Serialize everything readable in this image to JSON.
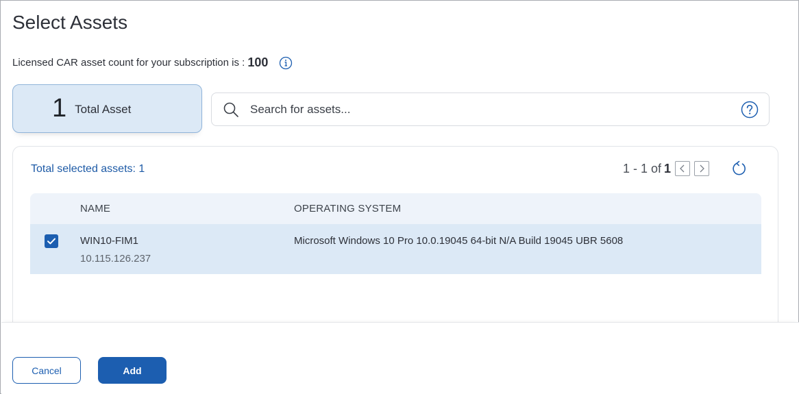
{
  "dialog": {
    "title": "Select Assets",
    "license_text": "Licensed CAR asset count for your subscription is :",
    "license_count": "100"
  },
  "summary": {
    "total_count": "1",
    "total_label": "Total Asset"
  },
  "search": {
    "placeholder": "Search for assets..."
  },
  "panel": {
    "selected_text": "Total selected assets: 1",
    "pager_text": "1 - 1 of",
    "pager_total": "1"
  },
  "table": {
    "columns": [
      "NAME",
      "OPERATING SYSTEM"
    ],
    "rows": [
      {
        "checked": true,
        "name": "WIN10-FIM1",
        "ip": "10.115.126.237",
        "os": "Microsoft Windows 10 Pro 10.0.19045 64-bit N/A Build 19045 UBR 5608"
      }
    ]
  },
  "footer": {
    "cancel_label": "Cancel",
    "add_label": "Add"
  },
  "icons": {
    "info": "info-icon",
    "search": "search-icon",
    "help": "help-icon",
    "prev": "chevron-left-icon",
    "next": "chevron-right-icon",
    "refresh": "refresh-icon",
    "check": "checkmark-icon"
  },
  "colors": {
    "accent": "#1c5eb0",
    "selected_row": "#dce9f6",
    "header_row": "#eef3fa"
  }
}
